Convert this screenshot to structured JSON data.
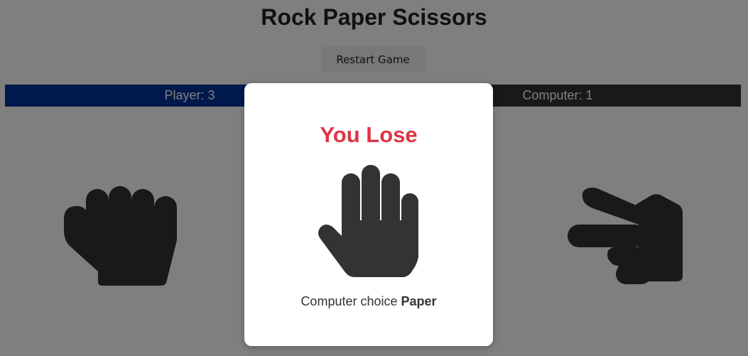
{
  "header": {
    "title": "Rock Paper Scissors",
    "restart_label": "Restart Game"
  },
  "scoreboard": {
    "player_label": "Player: 3",
    "computer_label": "Computer: 1"
  },
  "choices": [
    {
      "name": "rock",
      "icon": "hand-rock-icon"
    },
    {
      "name": "scissors",
      "icon": "hand-scissors-icon"
    }
  ],
  "modal": {
    "result": "You Lose",
    "message_prefix": "Computer choice",
    "computer_choice": "Paper",
    "icon": "hand-paper-icon"
  },
  "colors": {
    "player_bar": "#003399",
    "computer_bar": "#333333",
    "lose": "#dc3545",
    "icon": "#333333",
    "overlay": "rgba(0,0,0,0.5)"
  }
}
